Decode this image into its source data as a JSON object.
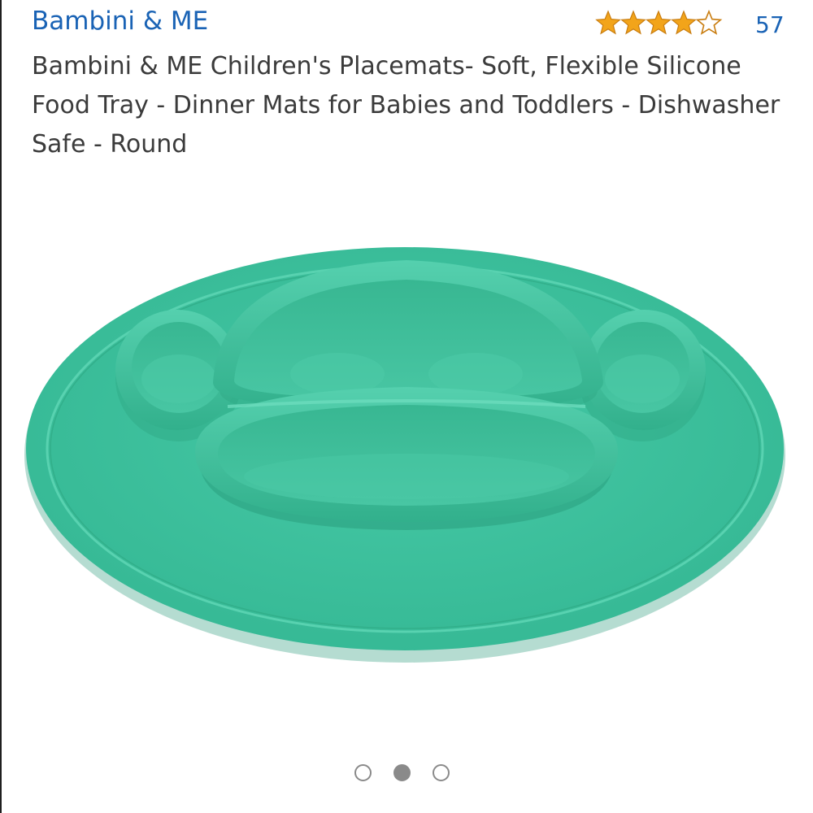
{
  "brand": {
    "label": "Bambini & ME"
  },
  "rating": {
    "stars": 4.0,
    "max_stars": 5,
    "review_count": "57",
    "star_color": "#f2a41a"
  },
  "product": {
    "title": "Bambini & ME Children's Placemats- Soft, Flexible Silicone Food Tray - Dinner Mats for Babies and Toddlers - Dishwasher Safe - Round",
    "image": {
      "subject": "green-silicone-divided-placemat",
      "color": "#3fc3a0"
    }
  },
  "carousel": {
    "total": 3,
    "active_index": 1
  },
  "colors": {
    "link": "#1a63b5",
    "text": "#3b3b3b",
    "dot": "#8a8a8a"
  }
}
